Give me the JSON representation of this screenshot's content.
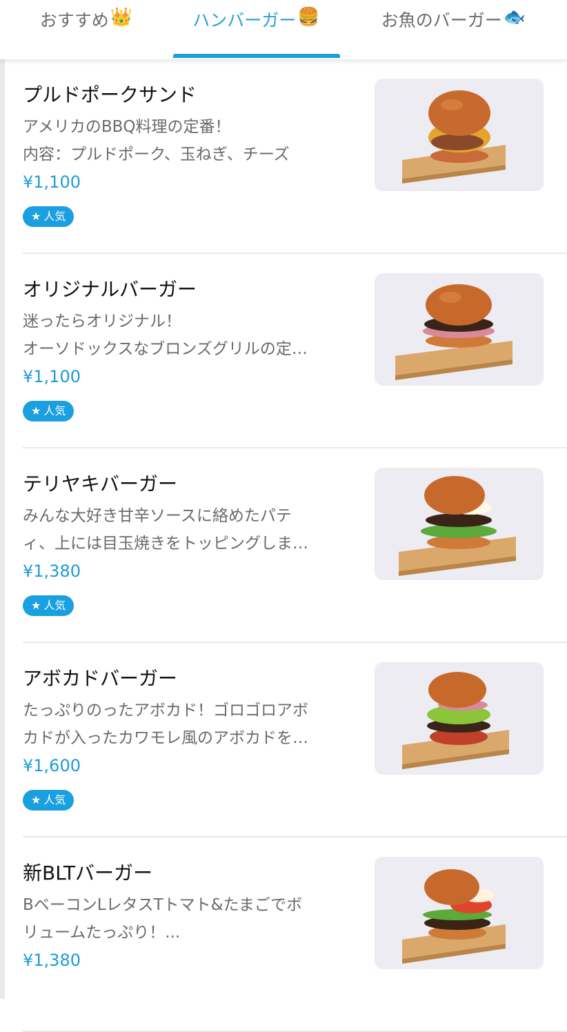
{
  "tabs": [
    {
      "label": "おすすめ",
      "emoji": "👑",
      "active": false
    },
    {
      "label": "ハンバーガー",
      "emoji": "🍔",
      "active": true
    },
    {
      "label": "お魚のバーガー",
      "emoji": "🐟",
      "active": false
    }
  ],
  "items": [
    {
      "name": "プルドポークサンド",
      "desc_lines": [
        "アメリカのBBQ料理の定番！",
        "内容：プルドポーク、玉ねぎ、チーズ"
      ],
      "price": "¥1,100",
      "badge": "人気",
      "image_icon": "pulled-pork-sandwich-image"
    },
    {
      "name": "オリジナルバーガー",
      "desc_lines": [
        "迷ったらオリジナル！",
        "オーソドックスなブロンズグリルの定…"
      ],
      "price": "¥1,100",
      "badge": "人気",
      "image_icon": "original-burger-image"
    },
    {
      "name": "テリヤキバーガー",
      "desc_lines": [
        "みんな大好き甘辛ソースに絡めたパテ",
        "ィ、上には目玉焼きをトッピングしま…"
      ],
      "price": "¥1,380",
      "badge": "人気",
      "image_icon": "teriyaki-burger-image"
    },
    {
      "name": "アボカドバーガー",
      "desc_lines": [
        "たっぷりのったアボカド！ゴロゴロアボ",
        "カドが入ったカワモレ風のアボカドを…"
      ],
      "price": "¥1,600",
      "badge": "人気",
      "image_icon": "avocado-burger-image"
    },
    {
      "name": "新BLTバーガー",
      "desc_lines": [
        "BベーコンLレタスTトマト&たまごでボ",
        "リュームたっぷり！..."
      ],
      "price": "¥1,380",
      "badge": "",
      "image_icon": "blt-burger-image"
    }
  ],
  "colors": {
    "accent": "#1aa0d8",
    "price": "#1e9bd7",
    "badge_bg": "#1a9fe0"
  }
}
